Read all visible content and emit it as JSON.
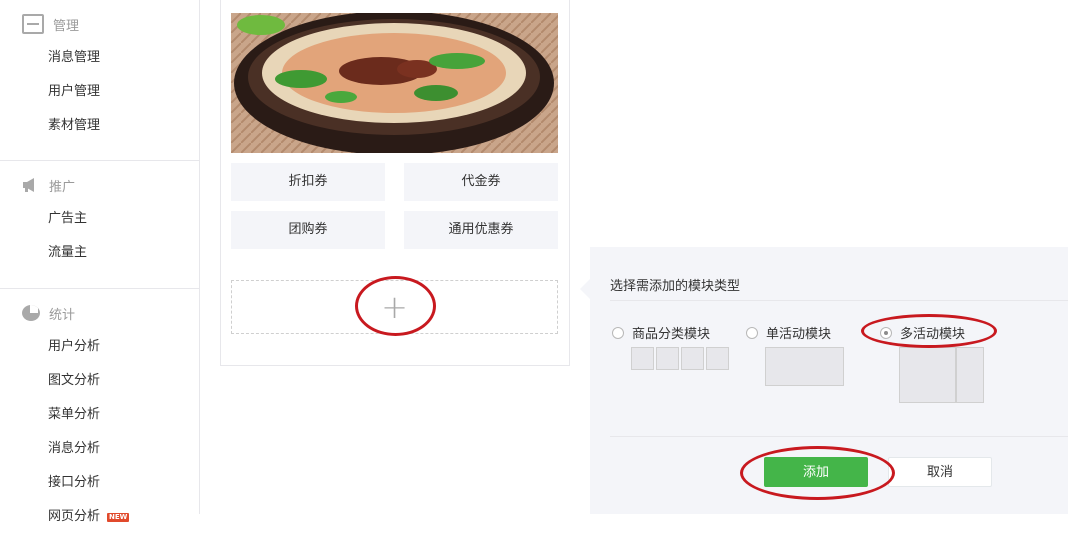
{
  "sidebar": {
    "groups": [
      {
        "title": "管理",
        "icon": "inbox-tray-icon",
        "items": [
          "消息管理",
          "用户管理",
          "素材管理"
        ]
      },
      {
        "title": "推广",
        "icon": "megaphone-icon",
        "items": [
          "广告主",
          "流量主"
        ]
      },
      {
        "title": "统计",
        "icon": "pie-chart-icon",
        "items": [
          "用户分析",
          "图文分析",
          "菜单分析",
          "消息分析",
          "接口分析",
          "网页分析"
        ]
      }
    ],
    "new_badge": "NEW"
  },
  "preview": {
    "image_alt": "bowl of rice noodles with beef",
    "coupons": [
      "折扣券",
      "代金券",
      "团购券",
      "通用优惠券"
    ],
    "add_symbol": "+"
  },
  "module_picker": {
    "title": "选择需添加的模块类型",
    "options": [
      {
        "label": "商品分类模块",
        "selected": false
      },
      {
        "label": "单活动模块",
        "selected": false
      },
      {
        "label": "多活动模块",
        "selected": true
      }
    ],
    "confirm_label": "添加",
    "cancel_label": "取消"
  },
  "colors": {
    "primary_green": "#44b549",
    "annotation_red": "#c8191f",
    "panel_bg": "#f4f5f9",
    "new_badge": "#e14a2c"
  }
}
